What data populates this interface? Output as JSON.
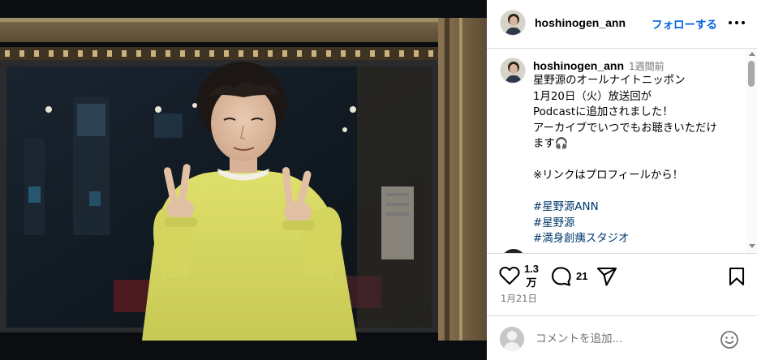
{
  "post": {
    "username": "hoshinogen_ann",
    "follow_label": "フォローする",
    "more_icon": "more-horizontal-icon",
    "caption": {
      "username": "hoshinogen_ann",
      "time_ago": "1週間前",
      "lines": [
        "星野源のオールナイトニッポン",
        "1月20日（火）放送回が",
        "Podcastに追加されました！",
        "アーカイブでいつでもお聴きいただけ",
        "ます🎧",
        "",
        "※リンクはプロフィールから！",
        ""
      ],
      "hashtags": [
        "#星野源ANN",
        "#星野源",
        "#満身創痍スタジオ"
      ]
    },
    "likes": {
      "line1": "1.3",
      "line2": "万"
    },
    "comment_count": "21",
    "date": "1月21日",
    "comment_placeholder": "コメントを追加...",
    "icons": [
      "heart-icon",
      "comment-icon",
      "share-icon",
      "bookmark-icon",
      "emoji-icon"
    ],
    "colors": {
      "link": "#0064e0",
      "hashtag": "#00376b",
      "muted": "#737373",
      "divider": "#dbdbdb",
      "sweater": "#d6d862"
    }
  }
}
